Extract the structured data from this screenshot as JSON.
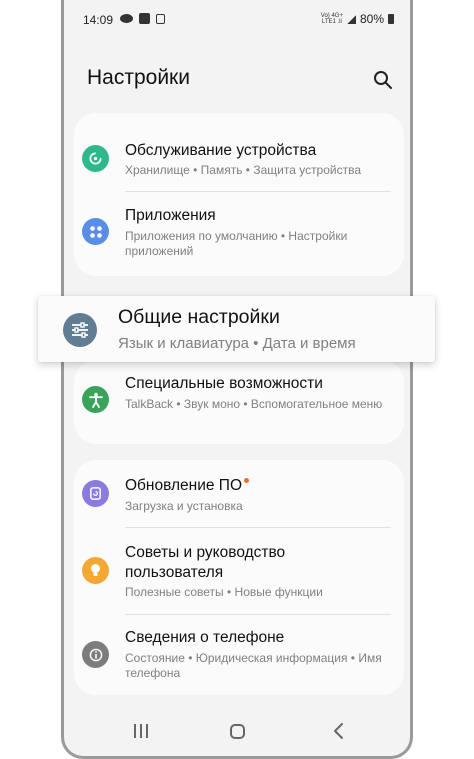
{
  "status": {
    "time": "14:09",
    "network": "Vo) 4G+\nLTE1 .ll",
    "battery": "80%"
  },
  "header": {
    "title": "Настройки"
  },
  "groups": [
    {
      "items": [
        {
          "title": "Обслуживание устройства",
          "sub": "Хранилище • Память • Защита устройства",
          "icon": "device-care-icon",
          "color": "#2fb88c"
        },
        {
          "title": "Приложения",
          "sub": "Приложения по умолчанию • Настройки приложений",
          "icon": "apps-icon",
          "color": "#5b8de8"
        }
      ]
    },
    {
      "items": [
        {
          "title": "Специальные возможности",
          "sub": "TalkBack • Звук моно • Вспомогательное меню",
          "icon": "accessibility-icon",
          "color": "#3aa35a"
        }
      ]
    },
    {
      "items": [
        {
          "title": "Обновление ПО",
          "sub": "Загрузка и установка",
          "icon": "software-update-icon",
          "color": "#8a7be0",
          "badge_color": "#e8712a"
        },
        {
          "title": "Советы и руководство пользователя",
          "sub": "Полезные советы • Новые функции",
          "icon": "tips-icon",
          "color": "#f5a733"
        },
        {
          "title": "Сведения о телефоне",
          "sub": "Состояние • Юридическая информация • Имя телефона",
          "icon": "about-phone-icon",
          "color": "#7d7d7d"
        }
      ]
    }
  ],
  "highlighted": {
    "title": "Общие настройки",
    "sub": "Язык и клавиатура • Дата и время",
    "icon": "general-management-icon",
    "color": "#607d94"
  }
}
